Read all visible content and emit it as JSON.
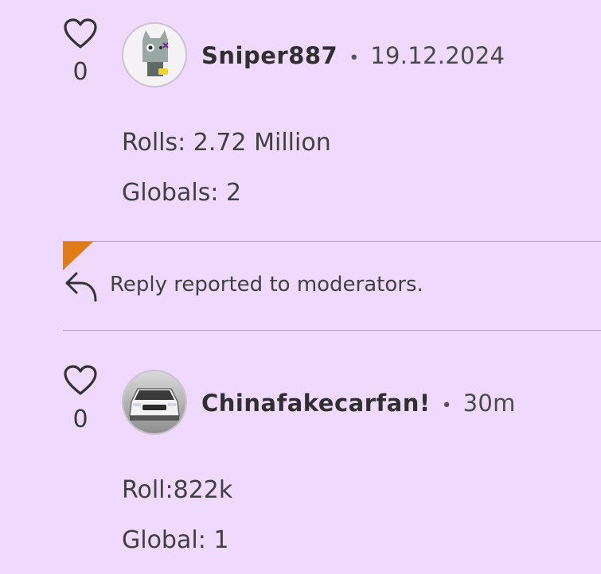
{
  "comments": [
    {
      "likes": "0",
      "username": "Sniper887",
      "separator": "•",
      "time": "19.12.2024",
      "lines": [
        "Rolls: 2.72 Million",
        "Globals: 2"
      ]
    },
    {
      "likes": "0",
      "username": "Chinafakecarfan!",
      "separator": "•",
      "time": "30m",
      "lines": [
        "Roll:822k",
        "Global: 1"
      ]
    }
  ],
  "report_notice": {
    "text": "Reply reported to moderators.",
    "flag_color": "#e07b1a",
    "icon": "reply-arrow-icon"
  },
  "colors": {
    "background": "#efd9fd",
    "divider": "#a9a3ad"
  }
}
